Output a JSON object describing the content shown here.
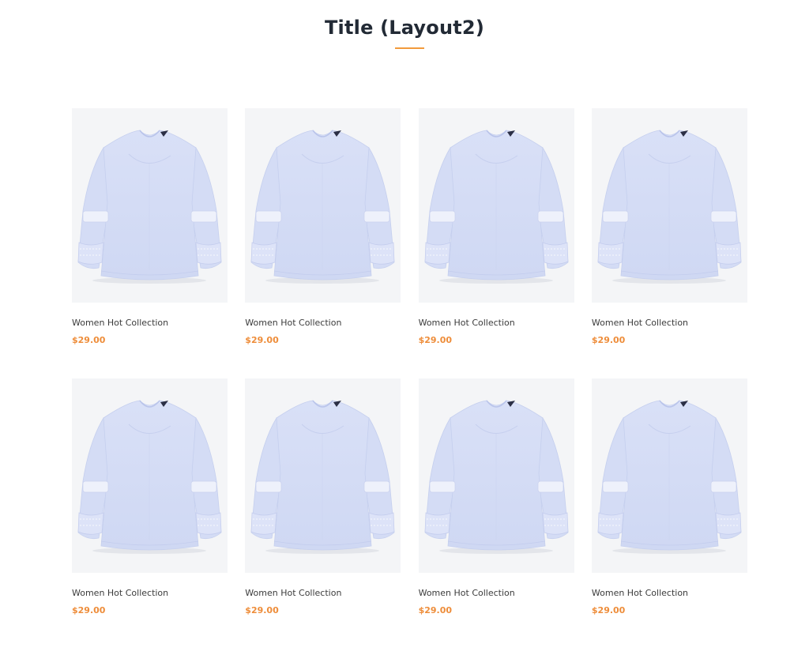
{
  "section": {
    "title": "Title (Layout2)"
  },
  "colors": {
    "accent": "#f29a3c",
    "price": "#ee8d3a",
    "image_bg": "#f4f5f7",
    "title": "#222a35"
  },
  "products": [
    {
      "name": "Women Hot Collection",
      "price": "$29.00",
      "image_icon": "blouse-image"
    },
    {
      "name": "Women Hot Collection",
      "price": "$29.00",
      "image_icon": "blouse-image"
    },
    {
      "name": "Women Hot Collection",
      "price": "$29.00",
      "image_icon": "blouse-image"
    },
    {
      "name": "Women Hot Collection",
      "price": "$29.00",
      "image_icon": "blouse-image"
    },
    {
      "name": "Women Hot Collection",
      "price": "$29.00",
      "image_icon": "blouse-image"
    },
    {
      "name": "Women Hot Collection",
      "price": "$29.00",
      "image_icon": "blouse-image"
    },
    {
      "name": "Women Hot Collection",
      "price": "$29.00",
      "image_icon": "blouse-image"
    },
    {
      "name": "Women Hot Collection",
      "price": "$29.00",
      "image_icon": "blouse-image"
    }
  ]
}
